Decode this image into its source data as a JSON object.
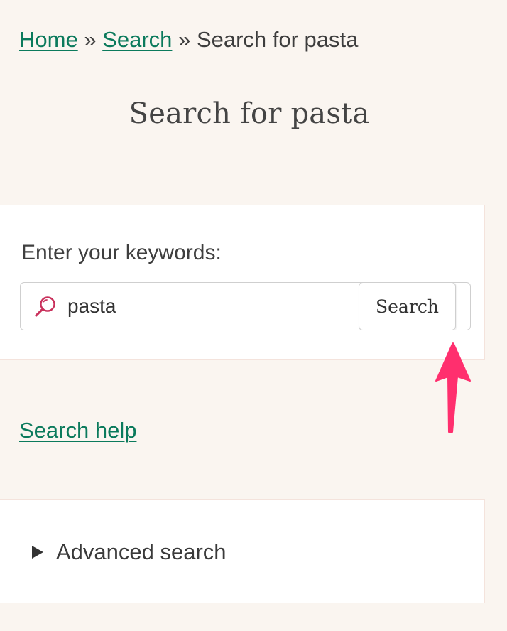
{
  "breadcrumb": {
    "home_label": "Home",
    "separator_1": "»",
    "search_label": "Search",
    "separator_2": "»",
    "current_label": "Search for pasta"
  },
  "page": {
    "title": "Search for pasta"
  },
  "search_form": {
    "keywords_label": "Enter your keywords:",
    "input_value": "pasta",
    "button_label": "Search",
    "icon": "search-magnifier-icon"
  },
  "help": {
    "link_label": "Search help"
  },
  "advanced": {
    "toggle_label": "Advanced search",
    "icon": "disclosure-triangle-icon",
    "expanded": false
  },
  "annotation": {
    "icon": "arrow-up-icon"
  },
  "colors": {
    "background": "#faf5f0",
    "panel": "#ffffff",
    "link": "#0b7a5c",
    "search_icon": "#c9315c",
    "arrow": "#ff2f6e"
  }
}
